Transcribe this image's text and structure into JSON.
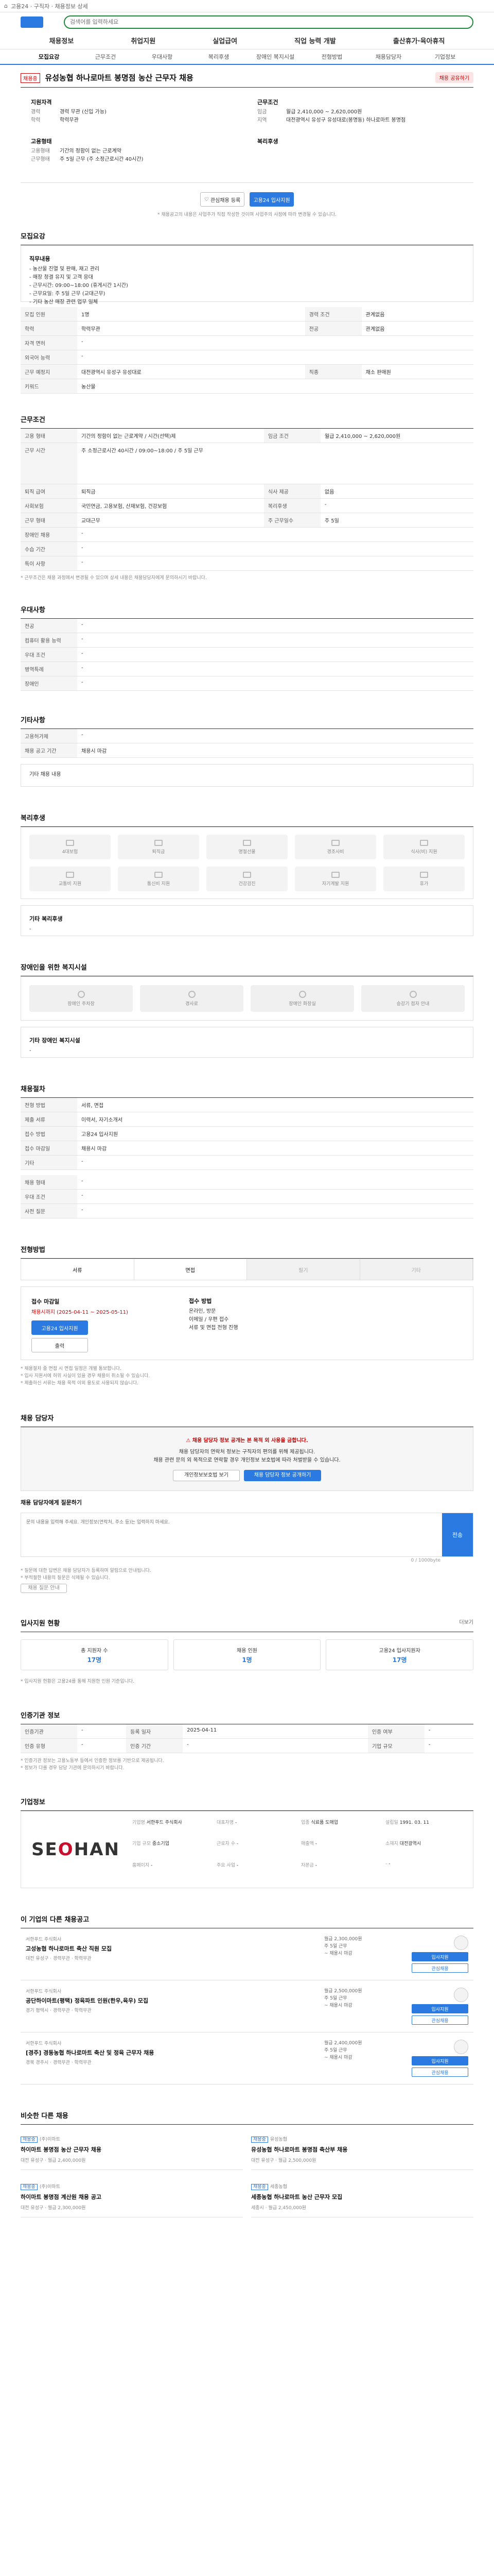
{
  "topbar": {
    "text": "고용24 · 구직자 · 채용정보 상세"
  },
  "search": {
    "placeholder": "검색어를 입력하세요"
  },
  "gnb": [
    "채용정보",
    "취업지원",
    "실업급여",
    "직업 능력 개발",
    "출산휴가·육아휴직"
  ],
  "tabs": [
    "모집요강",
    "근무조건",
    "우대사항",
    "복리후생",
    "장애인 복지시설",
    "전형방법",
    "채용담당자",
    "기업정보"
  ],
  "job": {
    "badge": "채용중",
    "title": "유성농협 하나로마트 봉명점 농산 근무자 채용",
    "share_label": "채용 공유하기",
    "left_head": "지원자격",
    "left_kv": [
      [
        "경력",
        "경력 무관 (신입 가능)"
      ],
      [
        "학력",
        "학력무관"
      ]
    ],
    "cond_head": "고용형태",
    "cond_kv": [
      [
        "고용형태",
        "기간의 정함이 없는 근로계약"
      ],
      [
        "근무형태",
        "주 5일 근무 (주 소정근로시간 40시간)"
      ]
    ],
    "right_head": "근무조건",
    "right_kv": [
      [
        "임금",
        "월급 2,410,000 ~ 2,620,000원"
      ],
      [
        "지역",
        "대전광역시 유성구 유성대로(봉명동) 하나로마트 봉명점"
      ]
    ],
    "welfare_head": "복리후생"
  },
  "actions": {
    "scrap": "관심채용 등록",
    "apply": "고용24 입사지원"
  },
  "notice": "* 채용공고의 내용은 사업주가 직접 작성한 것이며 사업주의 사정에 따라 변경될 수 있습니다.",
  "recruit": {
    "title": "모집요강",
    "duty_title": "직무내용",
    "duty_lines": [
      "- 농산물 진열 및 판매, 재고 관리",
      "- 매장 청결 유지 및 고객 응대",
      "- 근무시간: 09:00~18:00 (휴게시간 1시간)",
      "- 근무요일: 주 5일 근무 (교대근무)",
      "- 기타 농산 매장 관련 업무 일체"
    ],
    "rows": [
      [
        "모집 인원",
        "1명",
        "경력 조건",
        "관계없음"
      ],
      [
        "학력",
        "학력무관",
        "전공",
        "관계없음"
      ],
      [
        "자격 면허",
        "-",
        "",
        ""
      ],
      [
        "외국어 능력",
        "-",
        "",
        ""
      ],
      [
        "근무 예정지",
        "대전광역시 유성구 유성대로",
        "직종",
        "채소 판매원"
      ],
      [
        "키워드",
        "농산물",
        "",
        ""
      ]
    ]
  },
  "conditions": {
    "title": "근무조건",
    "rows": [
      [
        "고용 형태",
        "기간의 정함이 없는 근로계약 / 시간(선택)제",
        "임금 조건",
        "월급 2,410,000 ~ 2,620,000원"
      ],
      [
        "근무 시간",
        "주 소정근로시간 40시간 / 09:00~18:00 / 주 5일 근무",
        "",
        ""
      ],
      [
        "퇴직 급여",
        "퇴직금",
        "식사 제공",
        "없음"
      ],
      [
        "사회보험",
        "국민연금, 고용보험, 산재보험, 건강보험",
        "복리후생",
        "-"
      ],
      [
        "근무 형태",
        "교대근무",
        "주 근무일수",
        "주 5일"
      ],
      [
        "장애인 채용",
        "-",
        "",
        ""
      ],
      [
        "수습 기간",
        "-",
        "",
        ""
      ],
      [
        "특이 사항",
        "-",
        "",
        ""
      ]
    ],
    "note": "* 근무조건은 채용 과정에서 변경될 수 있으며 상세 내용은 채용담당자에게 문의하시기 바랍니다."
  },
  "prefer": {
    "title": "우대사항",
    "rows": [
      [
        "전공",
        "-"
      ],
      [
        "컴퓨터 활용 능력",
        "-"
      ],
      [
        "우대 조건",
        "-"
      ],
      [
        "병역특례",
        "-"
      ],
      [
        "장애인",
        "-"
      ]
    ]
  },
  "other": {
    "title": "기타사항",
    "rows": [
      [
        "고용허가제",
        "-"
      ],
      [
        "채용 공고 기간",
        "채용시 마감"
      ]
    ],
    "extra": "기타 채용 내용"
  },
  "welfare": {
    "title": "복리후생",
    "items": [
      "4대보험",
      "퇴직금",
      "명절선물",
      "경조사비",
      "식사(비) 지원",
      "교통비 지원",
      "통신비 지원",
      "건강검진",
      "자기계발 지원",
      "휴가"
    ],
    "more_label": "기타 복리후생",
    "more_value": "-"
  },
  "disability": {
    "title": "장애인을 위한 복지시설",
    "items": [
      "장애인 주차장",
      "경사로",
      "장애인 화장실",
      "승강기 점자 안내"
    ],
    "more_label": "기타 장애인 복지시설",
    "more_value": "-"
  },
  "process": {
    "title": "채용절차",
    "rows": [
      [
        "전형 방법",
        "서류, 면접"
      ],
      [
        "제출 서류",
        "이력서, 자기소개서"
      ],
      [
        "접수 방법",
        "고용24 입사지원"
      ],
      [
        "접수 마감일",
        "채용시 마감"
      ],
      [
        "기타",
        "-"
      ]
    ],
    "rows2": [
      [
        "채용 형태",
        "-"
      ],
      [
        "우대 조건",
        "-"
      ],
      [
        "사전 질문",
        "-"
      ]
    ]
  },
  "apply": {
    "title": "전형방법",
    "tabs": [
      "서류",
      "면접",
      "필기",
      "기타"
    ],
    "left_head": "접수 마감일",
    "left_value": "채용시까지 (2025-04-11 ~ 2025-05-11)",
    "apply_btn": "고용24 입사지원",
    "print_btn": "출력",
    "right_head": "접수 방법",
    "right_lines": [
      "온라인, 방문",
      "이메일 / 우편 접수",
      "서류 및 면접 전형 진행"
    ],
    "notes": [
      "* 채용절차 중 면접 시 면접 일정은 개별 통보합니다.",
      "* 입사 지원서에 허위 사실이 있을 경우 채용이 취소될 수 있습니다.",
      "* 제출하신 서류는 채용 목적 이외 용도로 사용되지 않습니다."
    ]
  },
  "manager": {
    "title": "채용 담당자",
    "alert": "채용 담당자 정보 공개는 본 목적 외 사용을 금합니다.",
    "desc": "채용 담당자의 연락처 정보는 구직자의 편의를 위해 제공됩니다.",
    "desc2": "채용 관련 문의 외 목적으로 연락할 경우 개인정보 보호법에 따라 처벌받을 수 있습니다.",
    "btn1": "개인정보보호법 보기",
    "btn2": "채용 담당자 정보 공개하기",
    "qa_label": "채용 담당자에게 질문하기",
    "qa_placeholder": "문의 내용을 입력해 주세요. 개인정보(연락처, 주소 등)는 입력하지 마세요.",
    "qa_count": "0 / 1000byte",
    "send": "전송",
    "qa_notes": [
      "* 질문에 대한 답변은 채용 담당자가 등록하며 알림으로 안내됩니다.",
      "* 부적절한 내용의 질문은 삭제될 수 있습니다."
    ],
    "qa_notice_btn": "채용 질문 안내"
  },
  "stats": {
    "title": "입사지원 현황",
    "link": "더보기",
    "items": [
      [
        "총 지원자 수",
        "17명"
      ],
      [
        "채용 인원",
        "1명"
      ],
      [
        "고용24 입사지원자",
        "17명"
      ]
    ],
    "note": "* 입사지원 현황은 고용24를 통해 지원한 인원 기준입니다."
  },
  "org": {
    "title": "인증기관 정보",
    "rows": [
      [
        "인증기관",
        "-",
        "등록 일자",
        "2025-04-11",
        "인증 여부",
        "-"
      ],
      [
        "인증 유형",
        "-",
        "인증 기간",
        "-",
        "기업 규모",
        "-"
      ]
    ],
    "notes": [
      "* 인증기관 정보는 고용노동부 등에서 인증한 정보를 기반으로 제공됩니다.",
      "* 정보가 다를 경우 담당 기관에 문의하시기 바랍니다."
    ]
  },
  "company": {
    "title": "기업정보",
    "logo_a": "SE",
    "logo_b": "O",
    "logo_c": "HAN",
    "info": [
      [
        "기업명",
        "서한푸드 주식회사"
      ],
      [
        "대표자명",
        "-"
      ],
      [
        "업종",
        "식료품 도매업"
      ],
      [
        "설립일",
        "1991. 03. 11"
      ],
      [
        "기업 규모",
        "중소기업"
      ],
      [
        "근로자 수",
        "-"
      ],
      [
        "매출액",
        "-"
      ],
      [
        "소재지",
        "대전광역시"
      ],
      [
        "홈페이지",
        "-"
      ],
      [
        "주요 사업",
        "-"
      ],
      [
        "자본금",
        "-"
      ],
      [
        "-",
        "-"
      ]
    ]
  },
  "other_jobs": {
    "title": "이 기업의 다른 채용공고",
    "items": [
      {
        "company": "서한푸드 주식회사",
        "title": "고성농협 하나로마트 축산 직원 모집",
        "meta": "대전 유성구 · 경력무관 · 학력무관",
        "mid": [
          "월급 2,300,000원",
          "주 5일 근무",
          "~ 채용시 마감"
        ],
        "btn1": "입사지원",
        "btn2": "관심채용"
      },
      {
        "company": "서한푸드 주식회사",
        "title": "공단하이마트(평택) 정육파트 인원(한우,육우) 모집",
        "meta": "경기 평택시 · 경력무관 · 학력무관",
        "mid": [
          "월급 2,500,000원",
          "주 5일 근무",
          "~ 채용시 마감"
        ],
        "btn1": "입사지원",
        "btn2": "관심채용"
      },
      {
        "company": "서한푸드 주식회사",
        "title": "[경주] 경동농협 하나로마트 축산 및 정육 근무자 채용",
        "meta": "경북 경주시 · 경력무관 · 학력무관",
        "mid": [
          "월급 2,400,000원",
          "주 5일 근무",
          "~ 채용시 마감"
        ],
        "btn1": "입사지원",
        "btn2": "관심채용"
      }
    ]
  },
  "recommend": {
    "title": "비슷한 다른 채용",
    "items": [
      {
        "tag": "채용중",
        "company": "(주)이마트",
        "title": "하이마트 봉명점 농산 근무자 채용",
        "meta": "대전 유성구 · 월급 2,400,000원"
      },
      {
        "tag": "채용중",
        "company": "유성농협",
        "title": "유성농협 하나로마트 봉명점 축산부 채용",
        "meta": "대전 유성구 · 월급 2,500,000원"
      },
      {
        "tag": "채용중",
        "company": "(주)이마트",
        "title": "하이마트 봉명점 계산원 채용 공고",
        "meta": "대전 유성구 · 월급 2,300,000원"
      },
      {
        "tag": "채용중",
        "company": "세종농협",
        "title": "세종농협 하나로마트 농산 근무자 모집",
        "meta": "세종시 · 월급 2,450,000원"
      }
    ]
  }
}
